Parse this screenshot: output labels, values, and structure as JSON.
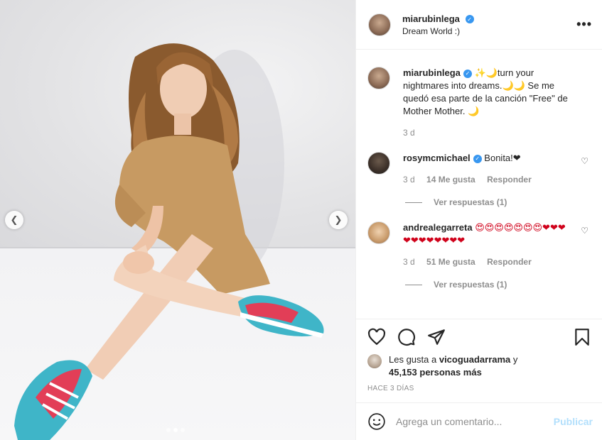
{
  "post": {
    "author": "miarubinlega",
    "location": "Dream World :)",
    "more_icon": "more-dots-icon"
  },
  "caption": {
    "username": "miarubinlega",
    "text": "✨🌙turn your nightmares into dreams.🌙🌙 Se me quedó esa parte de la canción \"Free\" de Mother Mother. 🌙",
    "time": "3 d"
  },
  "comments": [
    {
      "username": "rosymcmichael",
      "text": "Bonita!❤",
      "time": "3 d",
      "likes": "14 Me gusta",
      "reply": "Responder",
      "view_replies": "Ver respuestas (1)"
    },
    {
      "username": "andrealegarreta",
      "text": "😍😍😍😍😍😍😍❤❤❤❤❤❤❤❤❤❤❤",
      "time": "3 d",
      "likes": "51 Me gusta",
      "reply": "Responder",
      "view_replies": "Ver respuestas (1)"
    }
  ],
  "likes": {
    "prefix": "Les gusta a",
    "user": "vicoguadarrama",
    "conj": "y",
    "others": "45,153 personas más"
  },
  "timeago": "HACE 3 DÍAS",
  "add_comment": {
    "placeholder": "Agrega un comentario...",
    "publish": "Publicar"
  },
  "carousel": {
    "count": 3,
    "active_index": 1
  },
  "colors": {
    "verified": "#3897f0",
    "publish": "#b2dffc",
    "muted": "#8e8e8e"
  }
}
